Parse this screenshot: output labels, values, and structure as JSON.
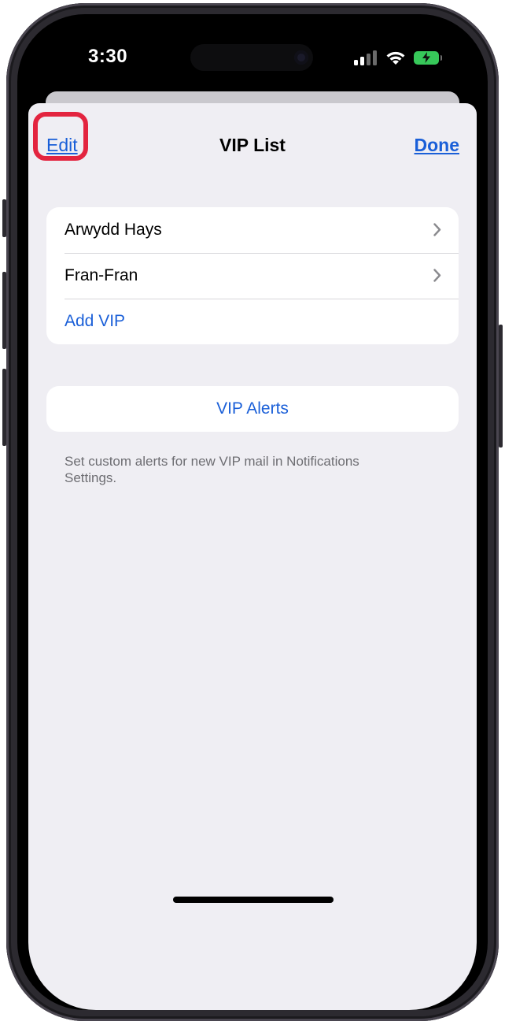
{
  "status_bar": {
    "time": "3:30"
  },
  "nav": {
    "title": "VIP List",
    "edit_label": "Edit",
    "done_label": "Done"
  },
  "vip_list": {
    "items": [
      {
        "label": "Arwydd Hays"
      },
      {
        "label": "Fran-Fran"
      }
    ],
    "add_label": "Add VIP"
  },
  "alerts": {
    "button_label": "VIP Alerts",
    "footer_note": "Set custom alerts for new VIP mail in Notifications Settings."
  },
  "colors": {
    "accent": "#1a5fd8",
    "highlight": "#e3243f",
    "battery": "#37c85a",
    "background": "#efeef3"
  }
}
